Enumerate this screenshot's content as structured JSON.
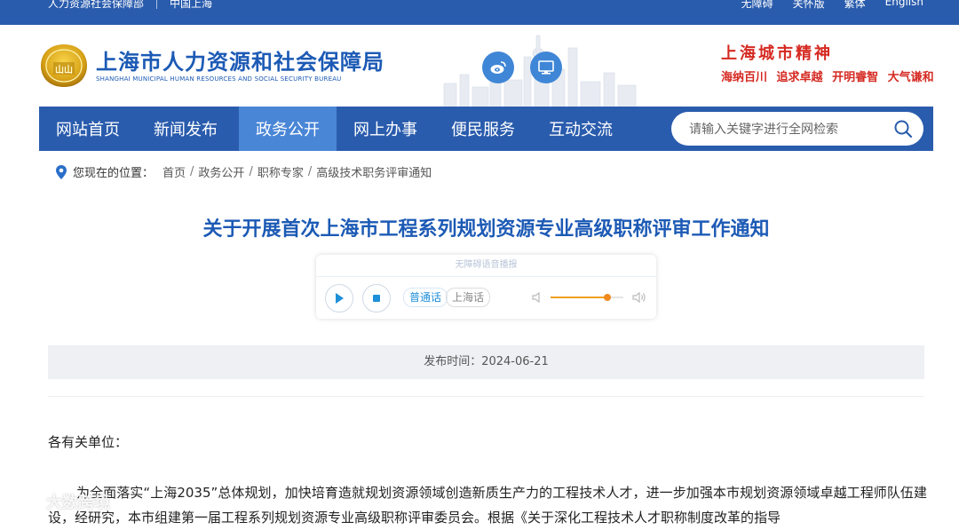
{
  "topbar": {
    "left": [
      "人力资源社会保障部",
      "中国上海"
    ],
    "right": [
      "无障碍",
      "关怀版",
      "繁体",
      "English"
    ]
  },
  "header": {
    "org_name_cn": "上海市人力资源和社会保障局",
    "org_name_en": "SHANGHAI MUNICIPAL HUMAN RESOURCES AND SOCIAL SECURITY BUREAU",
    "emblem_text": "山山",
    "spirit_title": "上海城市精神",
    "spirit_phrases": [
      "海纳百川",
      "追求卓越",
      "开明睿智",
      "大气谦和"
    ]
  },
  "nav": {
    "items": [
      "网站首页",
      "新闻发布",
      "政务公开",
      "网上办事",
      "便民服务",
      "互动交流"
    ],
    "active_index": 2,
    "search_placeholder": "请输入关键字进行全网检索"
  },
  "breadcrumb": {
    "label": "您现在的位置：",
    "items": [
      "首页",
      "政务公开",
      "职称专家",
      "高级技术职务评审通知"
    ]
  },
  "article": {
    "title": "关于开展首次上海市工程系列规划资源专业高级职称评审工作通知",
    "publish_time": "发布时间：2024-06-21",
    "salutation": "各有关单位：",
    "paragraph": "为全面落实“上海2035”总体规划，加快培育造就规划资源领域创造新质生产力的工程技术人才，进一步加强本市规划资源领域卓越工程师队伍建设，经研究，本市组建第一届工程系列规划资源专业高级职称评审委员会。根据《关于深化工程技术人才职称制度改革的指导"
  },
  "player": {
    "header_text": "无障碍语音播报",
    "lang_active": "普通话",
    "lang_other": "上海话",
    "volume": 0.78
  },
  "watermark": "大数跨境",
  "colors": {
    "primary_blue": "#2a5cad",
    "active_nav": "#4a86d6",
    "title_blue": "#1c5ab5",
    "spirit_red": "#d52a22",
    "volume_orange": "#f08a20"
  }
}
